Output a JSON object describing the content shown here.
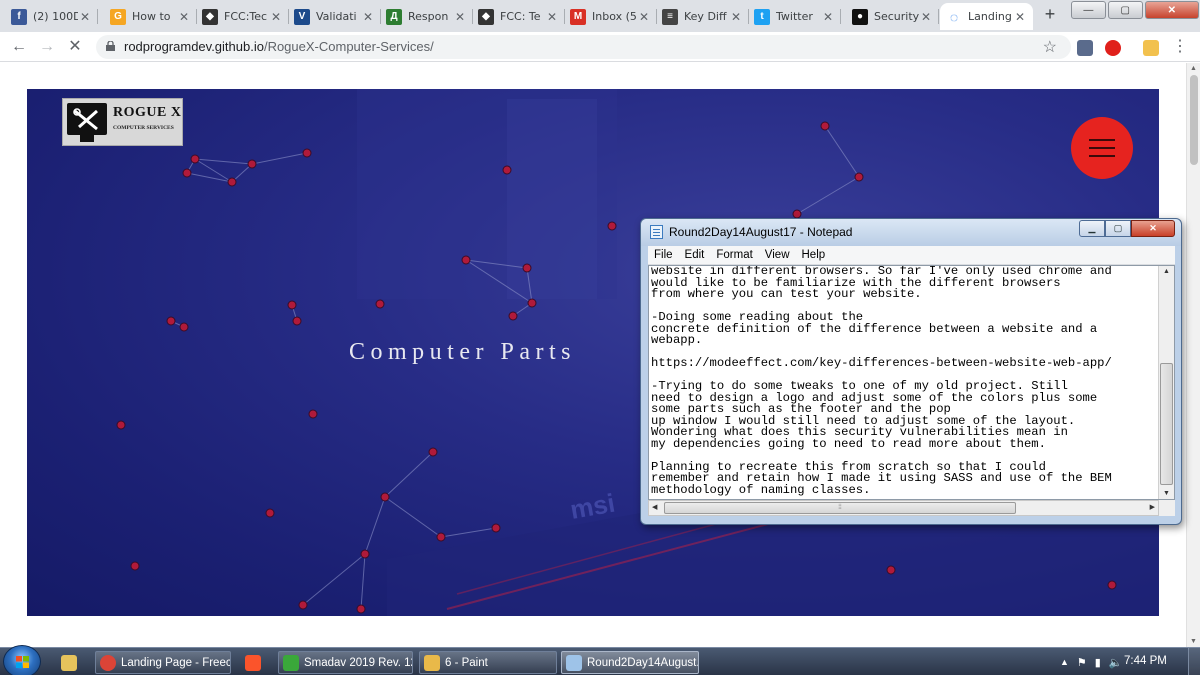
{
  "browser": {
    "tabs": [
      {
        "title": "(2) 100D",
        "icon": "facebook-icon",
        "color": "#3b5998",
        "glyph": "f"
      },
      {
        "title": "How to",
        "icon": "generic-site-icon",
        "color": "#f5a623",
        "glyph": "G"
      },
      {
        "title": "FCC:Tec",
        "icon": "freecodecamp-icon",
        "color": "#333333",
        "glyph": "◆"
      },
      {
        "title": "Validati",
        "icon": "w3c-validator-icon",
        "color": "#1c4a8b",
        "glyph": "V"
      },
      {
        "title": "Respon",
        "icon": "responsive-site-icon",
        "color": "#2e7d32",
        "glyph": "Д"
      },
      {
        "title": "FCC: Te",
        "icon": "freecodecamp-icon",
        "color": "#333333",
        "glyph": "◆"
      },
      {
        "title": "Inbox (5",
        "icon": "gmail-icon",
        "color": "#d93025",
        "glyph": "M"
      },
      {
        "title": "Key Diff",
        "icon": "document-icon",
        "color": "#444444",
        "glyph": "≡"
      },
      {
        "title": "Twitter",
        "icon": "twitter-icon",
        "color": "#1da1f2",
        "glyph": "t"
      },
      {
        "title": "Security",
        "icon": "github-icon",
        "color": "#111111",
        "glyph": "●"
      },
      {
        "title": "Landing",
        "icon": "loading-spinner-icon",
        "color": "#1a73e8",
        "glyph": "◌",
        "active": true
      }
    ],
    "new_tab": "+",
    "window_controls": {
      "minimize": "—",
      "maximize": "▢",
      "close": "✕"
    },
    "url_host": "rodprogramdev.github.io",
    "url_path": "/RogueX-Computer-Services/"
  },
  "site": {
    "logo_title": "ROGUE X",
    "logo_subtitle": "COMPUTER SERVICES",
    "heading": "Computer Parts"
  },
  "notepad": {
    "title": "Round2Day14August17 - Notepad",
    "menu": [
      "File",
      "Edit",
      "Format",
      "View",
      "Help"
    ],
    "lines": [
      "website in different browsers. So far I've only used chrome and",
      "would like to be familiarize with the different browsers",
      "from where you can test your website.",
      "",
      "-Doing some reading about the",
      "concrete definition of the difference between a website and a",
      "webapp.",
      "",
      "https://modeeffect.com/key-differences-between-website-web-app/",
      "",
      "-Trying to do some tweaks to one of my old project. Still",
      "need to design a logo and adjust some of the colors plus some",
      "some parts such as the footer and the pop",
      "up window I would still need to adjust some of the layout.",
      "Wondering what does this security vulnerabilities mean in",
      "my dependencies going to need to read more about them.",
      "",
      "Planning to recreate this from scratch so that I could",
      "remember and retain how I made it using SASS and use of the BEM",
      "methodology of naming classes."
    ]
  },
  "taskbar": {
    "items": [
      {
        "label": "",
        "icon": "windows-explorer-icon",
        "color": "#e6c35c"
      },
      {
        "label": "Landing Page - Freec...",
        "icon": "chrome-icon",
        "color": "#db4437"
      },
      {
        "label": "",
        "icon": "brave-icon",
        "color": "#fb542b"
      },
      {
        "label": "Smadav 2019 Rev. 12...",
        "icon": "smadav-icon",
        "color": "#3aa83a"
      },
      {
        "label": "6 - Paint",
        "icon": "paint-icon",
        "color": "#e9b949"
      },
      {
        "label": "Round2Day14August...",
        "icon": "notepad-icon",
        "color": "#9ec3e8"
      }
    ],
    "time": "7:44 PM"
  }
}
